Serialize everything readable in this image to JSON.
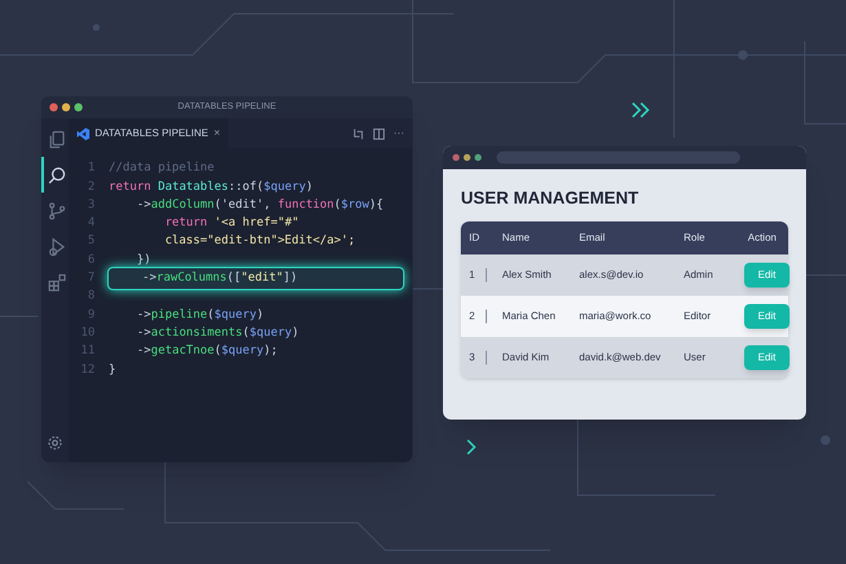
{
  "editor": {
    "title": "DATATABLES PIPELINE",
    "tab": {
      "label": "DATATABLES PIPELINE",
      "close": "×"
    },
    "actions_menu": "···",
    "code_lines": [
      {
        "number": "1",
        "highlighted": false,
        "tokens": [
          {
            "kind": "comment",
            "text": "//data pipeline"
          }
        ]
      },
      {
        "number": "2",
        "highlighted": false,
        "tokens": [
          {
            "kind": "keyword",
            "text": "return"
          },
          {
            "kind": "class",
            "text": " Datatables"
          },
          {
            "kind": "plain",
            "text": "::of("
          },
          {
            "kind": "variable",
            "text": "$query"
          },
          {
            "kind": "plain",
            "text": ")"
          }
        ]
      },
      {
        "number": "3",
        "highlighted": false,
        "tokens": [
          {
            "kind": "plain",
            "text": "    ->"
          },
          {
            "kind": "method",
            "text": "addColumn"
          },
          {
            "kind": "plain",
            "text": "('edit', "
          },
          {
            "kind": "keyword",
            "text": "function"
          },
          {
            "kind": "plain",
            "text": "("
          },
          {
            "kind": "variable",
            "text": "$row"
          },
          {
            "kind": "plain",
            "text": "){"
          }
        ]
      },
      {
        "number": "4",
        "highlighted": false,
        "tokens": [
          {
            "kind": "keyword",
            "text": "        return"
          },
          {
            "kind": "string",
            "text": " '<a href=\"#\""
          }
        ]
      },
      {
        "number": "5",
        "highlighted": false,
        "tokens": [
          {
            "kind": "string",
            "text": "        class=\"edit-btn\">Edit</a>';"
          }
        ]
      },
      {
        "number": "6",
        "highlighted": false,
        "tokens": [
          {
            "kind": "plain",
            "text": "    })"
          }
        ]
      },
      {
        "number": "7",
        "highlighted": true,
        "tokens": [
          {
            "kind": "plain",
            "text": "    ->"
          },
          {
            "kind": "method",
            "text": "rawColumns"
          },
          {
            "kind": "plain",
            "text": "(["
          },
          {
            "kind": "string",
            "text": "\"edit\""
          },
          {
            "kind": "plain",
            "text": "])"
          }
        ]
      },
      {
        "number": "8",
        "highlighted": false
      },
      {
        "number": "9",
        "highlighted": false,
        "tokens": [
          {
            "kind": "plain",
            "text": "    ->"
          },
          {
            "kind": "method",
            "text": "pipeline"
          },
          {
            "kind": "plain",
            "text": "("
          },
          {
            "kind": "variable",
            "text": "$query"
          },
          {
            "kind": "plain",
            "text": ")"
          }
        ]
      },
      {
        "number": "10",
        "highlighted": false,
        "tokens": [
          {
            "kind": "plain",
            "text": "    ->"
          },
          {
            "kind": "method",
            "text": "actionsiments"
          },
          {
            "kind": "plain",
            "text": "("
          },
          {
            "kind": "variable",
            "text": "$query"
          },
          {
            "kind": "plain",
            "text": ")"
          }
        ]
      },
      {
        "number": "11",
        "highlighted": false,
        "tokens": [
          {
            "kind": "plain",
            "text": "    ->"
          },
          {
            "kind": "method",
            "text": "getacTnoe"
          },
          {
            "kind": "plain",
            "text": "("
          },
          {
            "kind": "variable",
            "text": "$query"
          },
          {
            "kind": "plain",
            "text": ");"
          }
        ]
      },
      {
        "number": "12",
        "highlighted": false,
        "tokens": [
          {
            "kind": "plain",
            "text": "}"
          }
        ]
      }
    ],
    "activity_bar": [
      {
        "kind": "files",
        "selected": false
      },
      {
        "kind": "search",
        "selected": true
      },
      {
        "kind": "branch",
        "selected": false
      },
      {
        "kind": "debug",
        "selected": false
      },
      {
        "kind": "extensions",
        "selected": false
      }
    ]
  },
  "browser": {
    "heading": "USER MANAGEMENT",
    "table": {
      "columns": [
        "ID",
        "Name",
        "Email",
        "Role",
        "Action"
      ],
      "rows": [
        {
          "id": "1",
          "name": "Alex Smith",
          "email": "alex.s@dev.io",
          "role": "Admin",
          "action": "Edit"
        },
        {
          "id": "2",
          "name": "Maria Chen",
          "email": "maria@work.co",
          "role": "Editor",
          "action": "Edit"
        },
        {
          "id": "3",
          "name": "David Kim",
          "email": "david.k@web.dev",
          "role": "User",
          "action": "Edit"
        }
      ]
    }
  }
}
